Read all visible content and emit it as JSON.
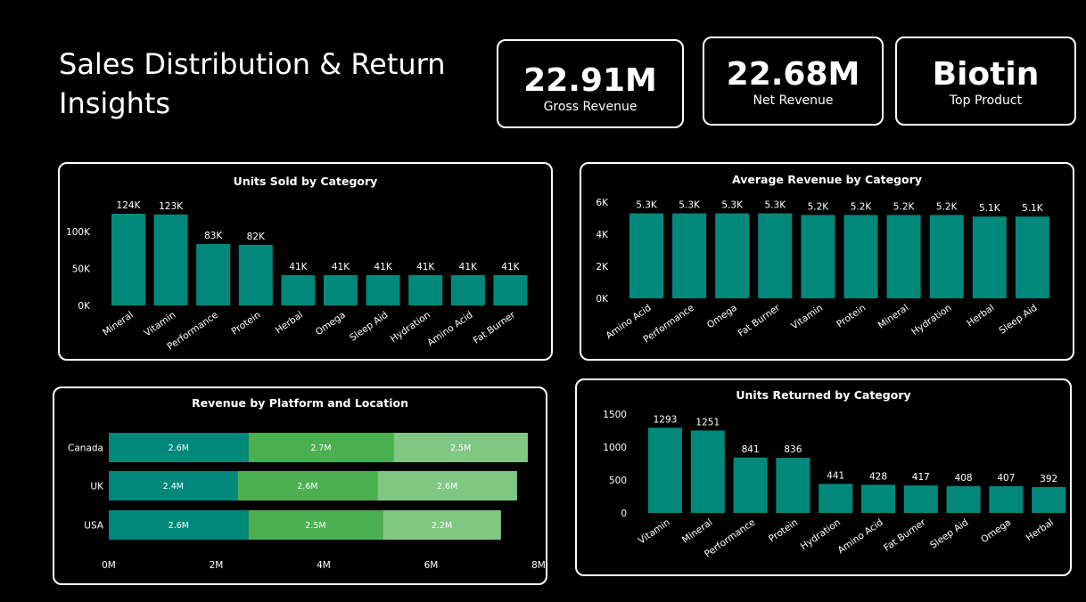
{
  "page": {
    "title": "Sales Distribution & Return Insights"
  },
  "kpis": [
    {
      "value": "22.91M",
      "label": "Gross Revenue"
    },
    {
      "value": "22.68M",
      "label": "Net Revenue"
    },
    {
      "value": "Biotin",
      "label": "Top Product"
    }
  ],
  "colors": {
    "bar": "#00897B",
    "stack": [
      "#00897B",
      "#4CAF50",
      "#81C784"
    ],
    "background": "#000000",
    "text": "#FFFFFF"
  },
  "chart_data": [
    {
      "id": "units_sold",
      "type": "bar",
      "title": "Units Sold by Category",
      "categories": [
        "Mineral",
        "Vitamin",
        "Performance",
        "Protein",
        "Herbal",
        "Omega",
        "Sleep Aid",
        "Hydration",
        "Amino Acid",
        "Fat Burner"
      ],
      "values": [
        124000,
        123000,
        83000,
        82000,
        41000,
        41000,
        41000,
        41000,
        41000,
        41000
      ],
      "data_labels": [
        "124K",
        "123K",
        "83K",
        "82K",
        "41K",
        "41K",
        "41K",
        "41K",
        "41K",
        "41K"
      ],
      "yticks": [
        0,
        50000,
        100000
      ],
      "ytick_labels": [
        "0K",
        "50K",
        "100K"
      ],
      "ylim": [
        0,
        124000
      ],
      "grid": false
    },
    {
      "id": "avg_revenue",
      "type": "bar",
      "title": "Average Revenue by Category",
      "categories": [
        "Amino Acid",
        "Performance",
        "Omega",
        "Fat Burner",
        "Vitamin",
        "Protein",
        "Mineral",
        "Hydration",
        "Herbal",
        "Sleep Aid"
      ],
      "values": [
        5300,
        5300,
        5300,
        5300,
        5200,
        5200,
        5200,
        5200,
        5100,
        5100
      ],
      "data_labels": [
        "5.3K",
        "5.3K",
        "5.3K",
        "5.3K",
        "5.2K",
        "5.2K",
        "5.2K",
        "5.2K",
        "5.1K",
        "5.1K"
      ],
      "yticks": [
        0,
        2000,
        4000,
        6000
      ],
      "ytick_labels": [
        "0K",
        "2K",
        "4K",
        "6K"
      ],
      "ylim": [
        0,
        6000
      ],
      "grid": false
    },
    {
      "id": "platform_location",
      "type": "bar",
      "orientation": "horizontal",
      "stacked": true,
      "title": "Revenue by Platform and Location",
      "categories": [
        "Canada",
        "UK",
        "USA"
      ],
      "series": [
        {
          "values": [
            2.6,
            2.4,
            2.6
          ],
          "data_labels": [
            "2.6M",
            "2.4M",
            "2.6M"
          ]
        },
        {
          "values": [
            2.7,
            2.6,
            2.5
          ],
          "data_labels": [
            "2.7M",
            "2.6M",
            "2.5M"
          ]
        },
        {
          "values": [
            2.5,
            2.6,
            2.2
          ],
          "data_labels": [
            "2.5M",
            "2.6M",
            "2.2M"
          ]
        }
      ],
      "xticks": [
        0,
        2,
        4,
        6,
        8
      ],
      "xtick_labels": [
        "0M",
        "2M",
        "4M",
        "6M",
        "8M"
      ],
      "xlim": [
        0,
        8
      ],
      "grid": false
    },
    {
      "id": "units_returned",
      "type": "bar",
      "title": "Units Returned by Category",
      "categories": [
        "Vitamin",
        "Mineral",
        "Performance",
        "Protein",
        "Hydration",
        "Amino Acid",
        "Fat Burner",
        "Sleep Aid",
        "Omega",
        "Herbal"
      ],
      "values": [
        1293,
        1251,
        841,
        836,
        441,
        428,
        417,
        408,
        407,
        392
      ],
      "data_labels": [
        "1293",
        "1251",
        "841",
        "836",
        "441",
        "428",
        "417",
        "408",
        "407",
        "392"
      ],
      "yticks": [
        0,
        500,
        1000,
        1500
      ],
      "ytick_labels": [
        "0",
        "500",
        "1000",
        "1500"
      ],
      "ylim": [
        0,
        1500
      ],
      "grid": false
    }
  ]
}
